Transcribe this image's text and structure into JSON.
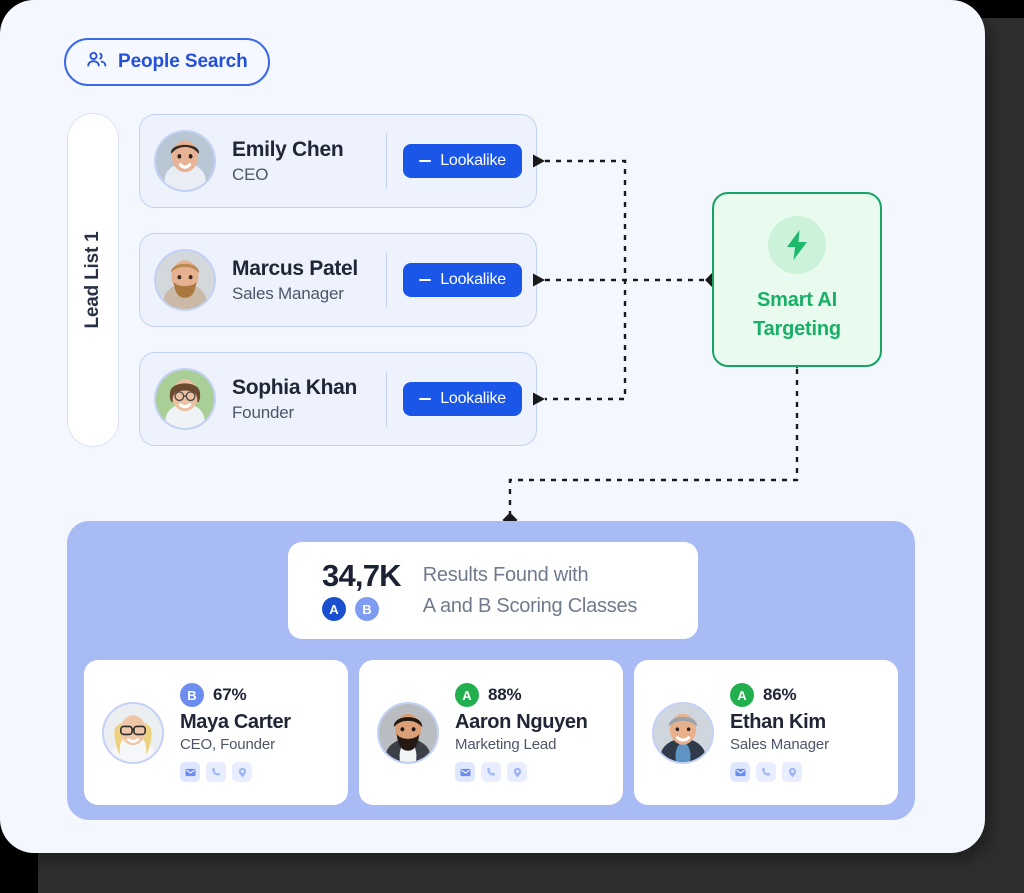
{
  "colors": {
    "app_bg": "#f4f7fe",
    "accent_blue": "#1a56e8",
    "accent_green": "#17a463",
    "panel_purple": "#a8bbf4",
    "badge_a_banner": "#1a4fd0",
    "badge_b_banner": "#7e9cf2",
    "badge_a_card": "#22b04f",
    "badge_b_card": "#6b8df0"
  },
  "header": {
    "people_search_label": "People Search",
    "people_search_icon": "people-icon"
  },
  "lead_list": {
    "rail_label": "Lead List 1",
    "items": [
      {
        "name": "Emily Chen",
        "role": "CEO",
        "button_label": "Lookalike",
        "button_icon": "minus-icon",
        "avatar": "woman-dark-hair"
      },
      {
        "name": "Marcus Patel",
        "role": "Sales Manager",
        "button_label": "Lookalike",
        "button_icon": "minus-icon",
        "avatar": "man-beard-blond"
      },
      {
        "name": "Sophia Khan",
        "role": "Founder",
        "button_label": "Lookalike",
        "button_icon": "minus-icon",
        "avatar": "woman-glasses-brown"
      }
    ]
  },
  "smart_ai": {
    "icon": "lightning-bolt-icon",
    "line1": "Smart AI",
    "line2": "Targeting"
  },
  "results": {
    "count": "34,7K",
    "headline_line1": "Results Found with",
    "headline_line2": "A and B Scoring Classes",
    "banner_badges": [
      {
        "label": "A",
        "color": "#1a4fd0"
      },
      {
        "label": "B",
        "color": "#7e9cf2"
      }
    ],
    "people": [
      {
        "badge": "B",
        "badge_color": "#6b8df0",
        "percent": "67%",
        "name": "Maya Carter",
        "role": "CEO, Founder",
        "avatar": "woman-blond-glasses",
        "contact_icons": [
          "email-icon",
          "phone-icon",
          "location-pin-icon"
        ]
      },
      {
        "badge": "A",
        "badge_color": "#22b04f",
        "percent": "88%",
        "name": "Aaron Nguyen",
        "role": "Marketing Lead",
        "avatar": "man-dark-beard",
        "contact_icons": [
          "email-icon",
          "phone-icon",
          "location-pin-icon"
        ]
      },
      {
        "badge": "A",
        "badge_color": "#22b04f",
        "percent": "86%",
        "name": "Ethan Kim",
        "role": "Sales Manager",
        "avatar": "man-grey-hair",
        "contact_icons": [
          "email-icon",
          "phone-icon",
          "location-pin-icon"
        ]
      }
    ]
  }
}
